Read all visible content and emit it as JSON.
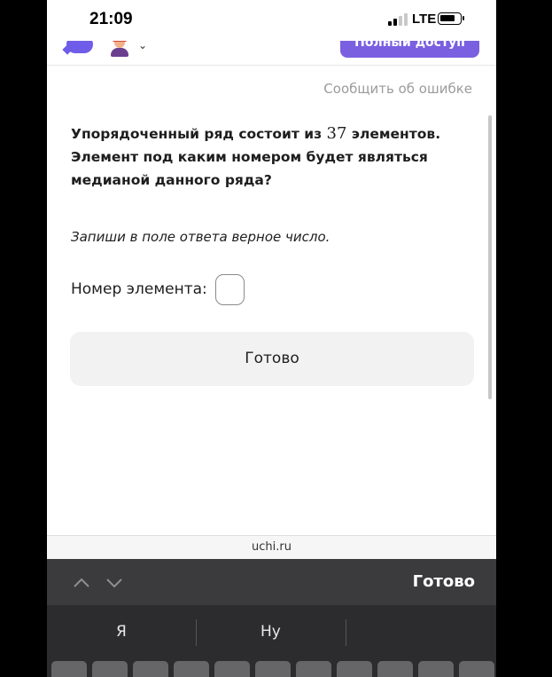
{
  "status_bar": {
    "time": "21:09",
    "network": "LTE"
  },
  "header": {
    "access_button": "Полный доступ"
  },
  "content": {
    "report_link": "Сообщить об ошибке",
    "question_before": "Упорядоченный ряд состоит из ",
    "question_number": "37",
    "question_after": " элементов. Элемент под каким номером будет являться медианой данного ряда?",
    "hint": "Запиши в поле ответа верное число.",
    "answer_label": "Номер элемента:",
    "answer_value": "",
    "done_button": "Готово"
  },
  "browser": {
    "url": "uchi.ru"
  },
  "keyboard": {
    "toolbar_done": "Готово",
    "suggestions": [
      "Я",
      "Ну",
      ""
    ]
  }
}
